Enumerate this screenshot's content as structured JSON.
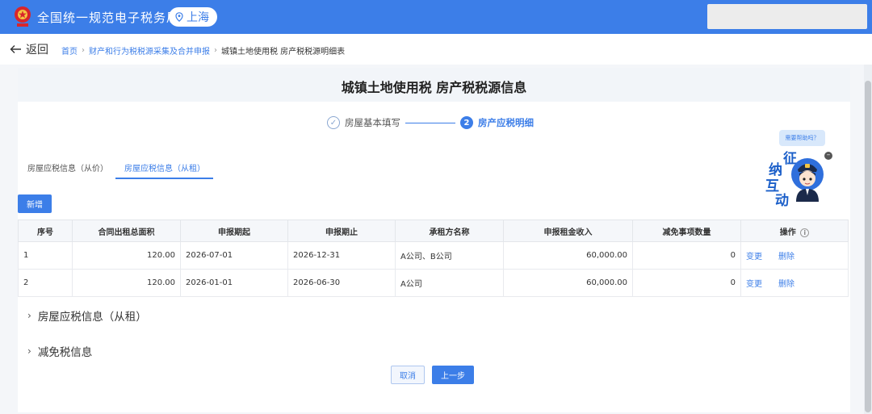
{
  "header": {
    "app_title": "全国统一规范电子税务局",
    "city": "上海",
    "brand_color": "#3c7ee8"
  },
  "breadcrumb": {
    "back_label": "返回",
    "items": [
      "首页",
      "财产和行为税税源采集及合并申报",
      "城镇土地使用税 房产税税源明细表"
    ]
  },
  "page": {
    "title": "城镇土地使用税 房产税税源信息"
  },
  "steps": [
    {
      "label": "房屋基本填写",
      "state": "done",
      "icon": "check-circle-icon"
    },
    {
      "label": "房产应税明细",
      "state": "active",
      "number": "2"
    }
  ],
  "tabs": [
    {
      "label": "房屋应税信息（从价）",
      "active": false
    },
    {
      "label": "房屋应税信息（从租）",
      "active": true
    }
  ],
  "actions": {
    "add_label": "新增",
    "cancel_label": "取消",
    "prev_label": "上一步"
  },
  "table": {
    "columns": [
      "序号",
      "合同出租总面积",
      "申报期起",
      "申报期止",
      "承租方名称",
      "申报租金收入",
      "减免事项数量",
      "操作"
    ],
    "rows": [
      {
        "index": "1",
        "area": "120.00",
        "start": "2026-07-01",
        "end": "2026-12-31",
        "tenant": "A公司、B公司",
        "income": "60,000.00",
        "relief_count": "0",
        "op_edit": "变更",
        "op_delete": "删除"
      },
      {
        "index": "2",
        "area": "120.00",
        "start": "2026-01-01",
        "end": "2026-06-30",
        "tenant": "A公司",
        "income": "60,000.00",
        "relief_count": "0",
        "op_edit": "变更",
        "op_delete": "删除"
      }
    ]
  },
  "sections": [
    {
      "label": "房屋应税信息（从租）",
      "icon": "chevron-right-icon"
    },
    {
      "label": "减免税信息",
      "icon": "chevron-right-icon"
    }
  ],
  "helper": {
    "bubble": "需要帮助吗？",
    "chars": [
      "征",
      "纳",
      "互",
      "动"
    ]
  }
}
